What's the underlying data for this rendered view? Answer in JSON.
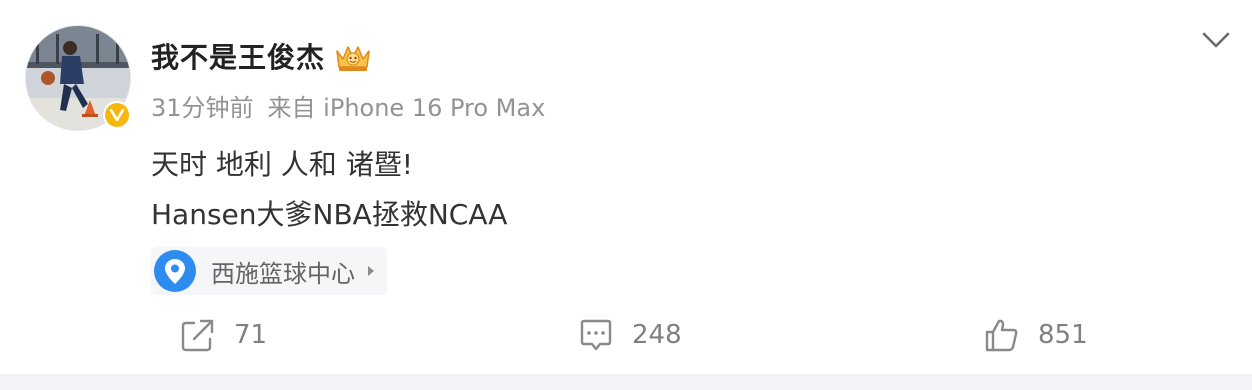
{
  "post": {
    "username": "我不是王俊杰",
    "time": "31分钟前",
    "source": "来自 iPhone 16 Pro Max",
    "content": {
      "line1": "天时 地利 人和 诸暨!",
      "line2": "Hansen大爹NBA拯救NCAA"
    },
    "location": "西施篮球中心"
  },
  "actions": {
    "repost": "71",
    "comment": "248",
    "like": "851"
  },
  "icons": {
    "verified": "verified-v-icon",
    "crown": "crown-badge-icon",
    "menu": "chevron-down-icon",
    "location": "location-pin-icon",
    "repost": "repost-icon",
    "comment": "comment-icon",
    "like": "thumbs-up-icon"
  },
  "colors": {
    "verified": "#f6b60c",
    "pin": "#2e8cf0",
    "meta_text": "#939393"
  }
}
